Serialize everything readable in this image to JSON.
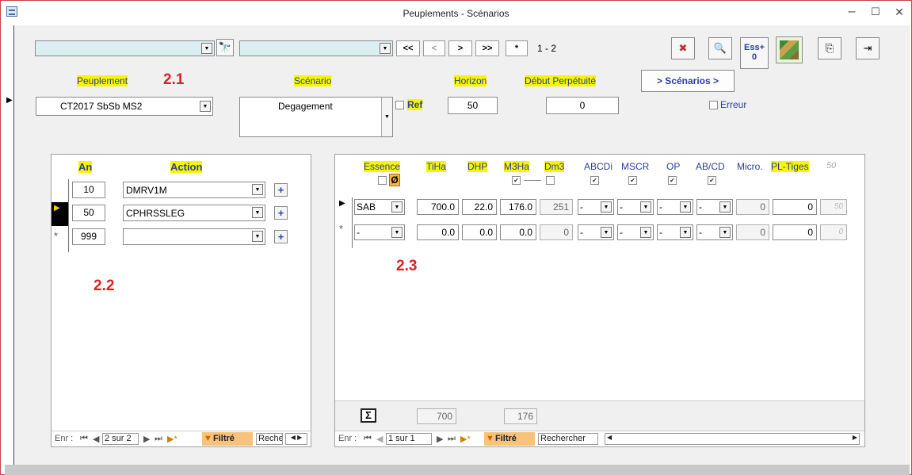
{
  "window": {
    "title": "Peuplements - Scénarios",
    "minimize": "–",
    "maximize": "☐",
    "close": "✕"
  },
  "top": {
    "nav_first": "<<",
    "nav_prev": "<",
    "nav_next": ">",
    "nav_last": ">>",
    "nav_new": "*",
    "record_count": "1 - 2",
    "ess_label": "Ess+",
    "ess_count": "0",
    "scenarios_button": "> Scénarios >"
  },
  "labels": {
    "peuplement": "Peuplement",
    "scenario": "Scénario",
    "horizon": "Horizon",
    "debut": "Début Perpétuité",
    "ref": "Ref",
    "erreur": "Erreur"
  },
  "annotations": {
    "a21": "2.1",
    "a22": "2.2",
    "a23": "2.3"
  },
  "fields": {
    "peuplement": "CT2017 SbSb MS2",
    "scenario": "Degagement",
    "horizon": "50",
    "debut": "0"
  },
  "actions_panel": {
    "headers": {
      "an": "An",
      "action": "Action"
    },
    "rows": [
      {
        "an": "10",
        "action": "DMRV1M"
      },
      {
        "an": "50",
        "action": "CPHRSSLEG"
      },
      {
        "an": "999",
        "action": ""
      }
    ],
    "nav": {
      "label": "Enr :",
      "record": "2 sur 2",
      "filter": "Filtré",
      "search": "Reche"
    }
  },
  "species_panel": {
    "headers": {
      "essence": "Essence",
      "tiha": "TiHa",
      "dhp": "DHP",
      "m3ha": "M3Ha",
      "dm3": "Dm3",
      "abcdi": "ABCDi",
      "mscr": "MSCR",
      "op": "OP",
      "abcd": "AB/CD",
      "micro": "Micro.",
      "pltiges": "PL-Tiges",
      "fifty": "50"
    },
    "null_symbol": "Ø",
    "rows": [
      {
        "essence": "SAB",
        "tiha": "700.0",
        "dhp": "22.0",
        "m3ha": "176.0",
        "dm3": "251",
        "abcdi": "-",
        "mscr": "-",
        "op": "-",
        "abcd": "-",
        "micro": "0",
        "pl": "0",
        "col50": "50"
      },
      {
        "essence": "-",
        "tiha": "0.0",
        "dhp": "0.0",
        "m3ha": "0.0",
        "dm3": "0",
        "abcdi": "-",
        "mscr": "-",
        "op": "-",
        "abcd": "-",
        "micro": "0",
        "pl": "0",
        "col50": "0"
      }
    ],
    "totals": {
      "sigma": "Σ",
      "tiha": "700",
      "m3ha": "176"
    },
    "nav": {
      "label": "Enr :",
      "record": "1 sur 1",
      "filter": "Filtré",
      "search": "Rechercher"
    }
  }
}
